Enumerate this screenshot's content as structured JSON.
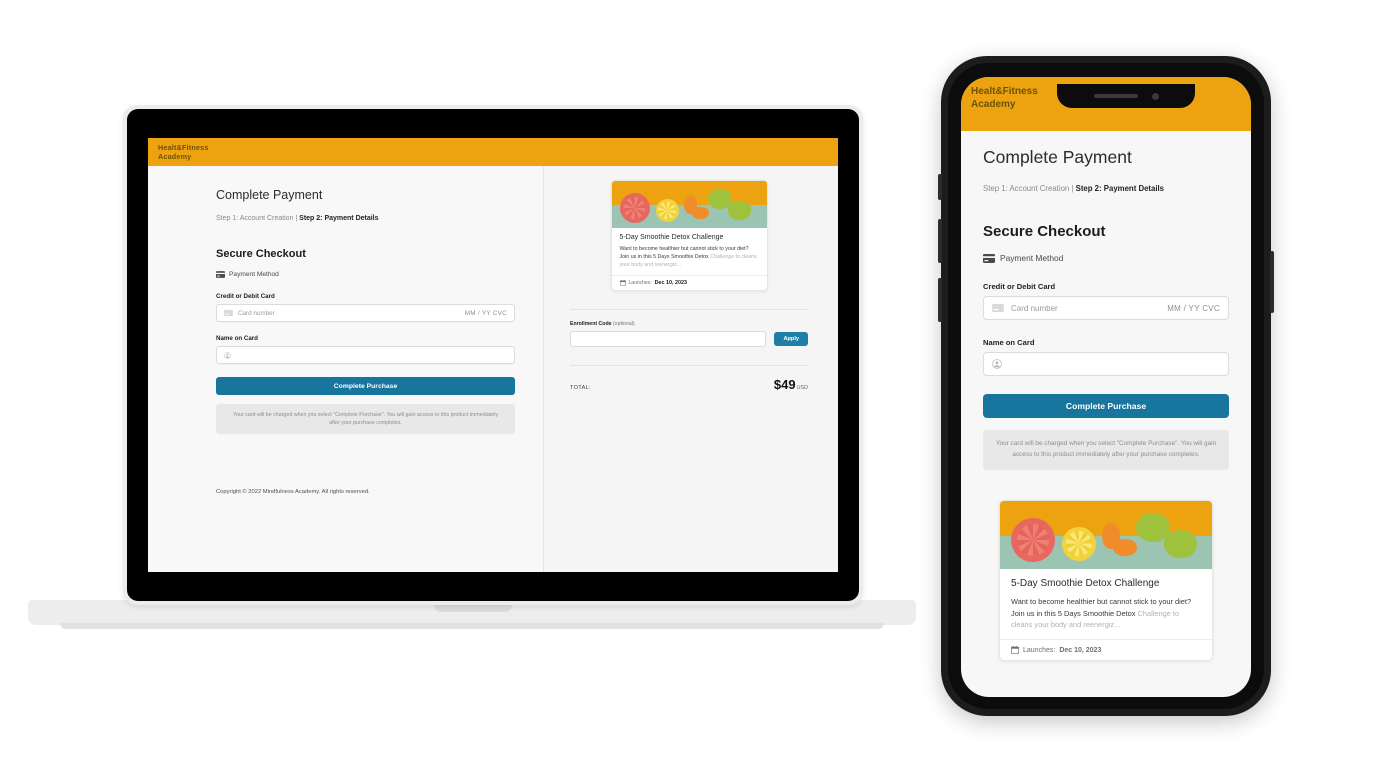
{
  "brand": {
    "logo_line1": "Healt&Fitness",
    "logo_line2": "Academy",
    "header_color": "#eda310",
    "accent_button_color": "#17759e"
  },
  "page": {
    "title": "Complete Payment",
    "steps_inactive": "Step 1: Account Creation | ",
    "steps_active": "Step 2: Payment Details",
    "section_title": "Secure Checkout",
    "payment_method_label": "Payment Method",
    "card_label": "Credit or Debit Card",
    "card_placeholder": "Card number",
    "card_expiry_cvc": "MM / YY  CVC",
    "name_label": "Name on Card",
    "name_value": "",
    "submit_label": "Complete Purchase",
    "charge_notice": "Your card will be charged when you select \"Complete Purchase\". You will gain access to this product immediately after your purchase completes.",
    "copyright": "Copyright © 2022 Mindfulness Academy. All rights reserved."
  },
  "product": {
    "title": "5-Day Smoothie Detox Challenge",
    "description_visible": "Want to become healthier but cannot stick to your diet? Join us in this 5 Days Smoothie Detox ",
    "description_faded": "Challenge to cleans your body and reenergiz...",
    "launch_label": "Launches:",
    "launch_date": "Dec 10, 2023",
    "image_alt": "citrus-fruits-photo"
  },
  "order": {
    "enrollment_label": "Enrollment Code ",
    "enrollment_optional": "(optional)",
    "enrollment_value": "",
    "apply_label": "Apply",
    "total_label": "TOTAL:",
    "total_amount": "$49",
    "total_currency": "USD"
  },
  "icons": {
    "credit_card": "credit-card-icon",
    "user": "user-icon",
    "calendar": "calendar-icon"
  }
}
